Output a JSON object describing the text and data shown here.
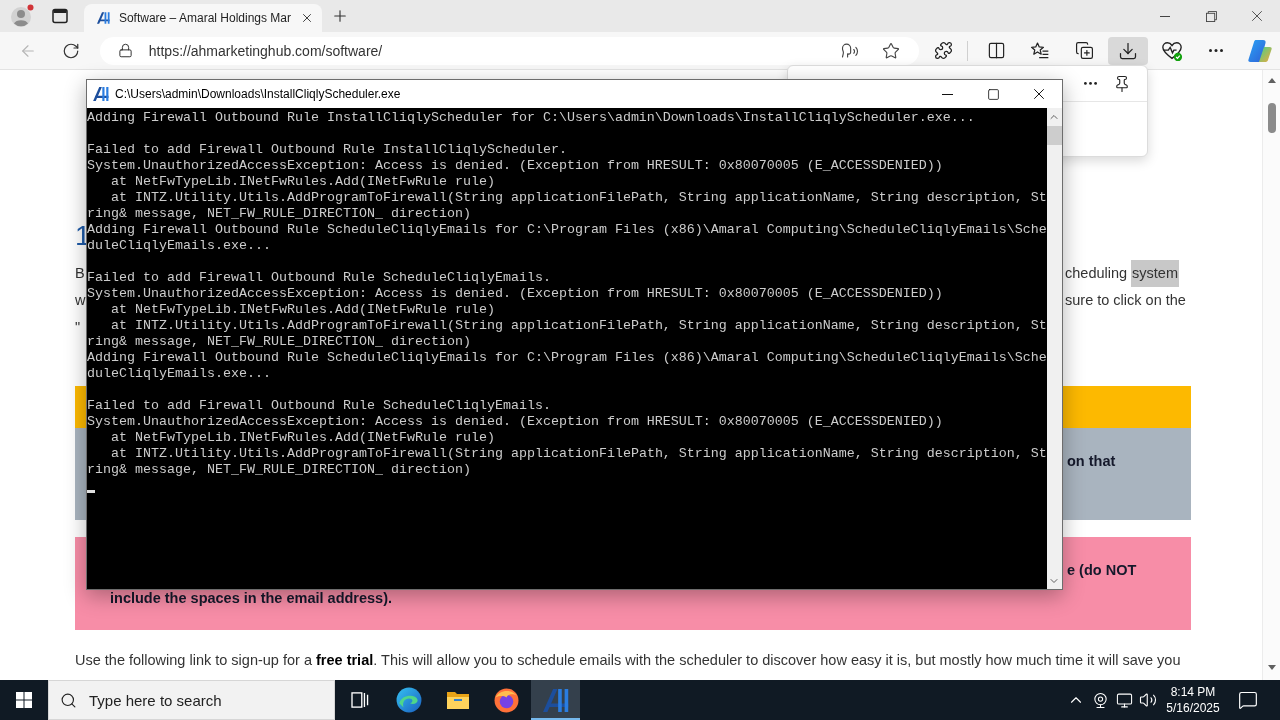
{
  "browser": {
    "profile_alert": true,
    "tabs": [
      {
        "title": "Software – Amaral Holdings Mar",
        "selected": true
      }
    ],
    "back_disabled": true,
    "url": "https://ahmarketinghub.com/software/",
    "downloads_open": true
  },
  "page": {
    "heading": "1",
    "paragraph_lines": [
      {
        "left": "B",
        "right": [
          {
            "text": "cheduling",
            "highlighted": false
          },
          {
            "text": "system",
            "highlighted": true
          }
        ]
      },
      {
        "left": "w",
        "right": [
          {
            "text": "sure to click on the",
            "highlighted": false
          }
        ]
      },
      {
        "left": "\""
      }
    ],
    "bands": [
      {
        "kind": "header",
        "color": "#fdb900"
      },
      {
        "kind": "body",
        "color": "#a9b4bf",
        "lines": [
          {
            "right": "on that"
          }
        ]
      },
      {
        "kind": "body",
        "color": "#f78da7",
        "lines": [
          {
            "right": "e (do NOT"
          },
          {
            "left": "include the spaces in the email address)."
          }
        ]
      }
    ],
    "trial_text": "Use the following link to sign-up for a **free trial**. This will allow you to schedule emails with the scheduler to discover how easy it is, but mostly how much time it will save you"
  },
  "console_window": {
    "title": "C:\\Users\\admin\\Downloads\\InstallCliqlyScheduler.exe",
    "blocks": [
      [
        {
          "kind": "plain",
          "text": "Adding Firewall Outbound Rule InstallCliqlyScheduler for C:\\Users\\admin\\Downloads\\InstallCliqlyScheduler.exe..."
        }
      ],
      [
        {
          "kind": "plain",
          "text": "Failed to add Firewall Outbound Rule InstallCliqlyScheduler."
        },
        {
          "kind": "plain",
          "text": "System.UnauthorizedAccessException: Access is denied. (Exception from HRESULT: 0x80070005 (E_ACCESSDENIED))"
        },
        {
          "kind": "frame",
          "text": "at NetFwTypeLib.INetFwRules.Add(INetFwRule rule)"
        },
        {
          "kind": "frame",
          "text": "at INTZ.Utility.Utils.AddProgramToFirewall(String applicationFilePath, String applicationName, String description, St"
        },
        {
          "kind": "plain",
          "text": "ring& message, NET_FW_RULE_DIRECTION_ direction)"
        },
        {
          "kind": "plain",
          "text": "Adding Firewall Outbound Rule ScheduleCliqlyEmails for C:\\Program Files (x86)\\Amaral Computing\\ScheduleCliqlyEmails\\Sche"
        },
        {
          "kind": "plain",
          "text": "duleCliqlyEmails.exe..."
        }
      ],
      [
        {
          "kind": "plain",
          "text": "Failed to add Firewall Outbound Rule ScheduleCliqlyEmails."
        },
        {
          "kind": "plain",
          "text": "System.UnauthorizedAccessException: Access is denied. (Exception from HRESULT: 0x80070005 (E_ACCESSDENIED))"
        },
        {
          "kind": "frame",
          "text": "at NetFwTypeLib.INetFwRules.Add(INetFwRule rule)"
        },
        {
          "kind": "frame",
          "text": "at INTZ.Utility.Utils.AddProgramToFirewall(String applicationFilePath, String applicationName, String description, St"
        },
        {
          "kind": "plain",
          "text": "ring& message, NET_FW_RULE_DIRECTION_ direction)"
        },
        {
          "kind": "plain",
          "text": "Adding Firewall Outbound Rule ScheduleCliqlyEmails for C:\\Program Files (x86)\\Amaral Computing\\ScheduleCliqlyEmails\\Sche"
        },
        {
          "kind": "plain",
          "text": "duleCliqlyEmails.exe..."
        }
      ],
      [
        {
          "kind": "plain",
          "text": "Failed to add Firewall Outbound Rule ScheduleCliqlyEmails."
        },
        {
          "kind": "plain",
          "text": "System.UnauthorizedAccessException: Access is denied. (Exception from HRESULT: 0x80070005 (E_ACCESSDENIED))"
        },
        {
          "kind": "frame",
          "text": "at NetFwTypeLib.INetFwRules.Add(INetFwRule rule)"
        },
        {
          "kind": "frame",
          "text": "at INTZ.Utility.Utils.AddProgramToFirewall(String applicationFilePath, String applicationName, String description, St"
        },
        {
          "kind": "plain",
          "text": "ring& message, NET_FW_RULE_DIRECTION_ direction)"
        }
      ]
    ],
    "cursor_visible": true
  },
  "taskbar": {
    "search_placeholder": "Type here to search",
    "apps": [
      {
        "kind": "task_view",
        "selected": false
      },
      {
        "kind": "edge",
        "selected": false
      },
      {
        "kind": "explorer",
        "selected": false
      },
      {
        "kind": "firefox",
        "selected": false
      },
      {
        "kind": "installer",
        "selected": true
      }
    ],
    "time": "8:14 PM",
    "date": "5/16/2025"
  }
}
